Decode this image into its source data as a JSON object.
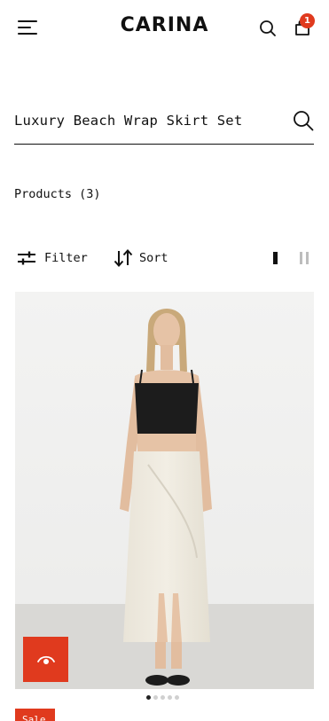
{
  "header": {
    "logo": "CARINA",
    "menu_icon": "hamburger-menu-icon",
    "search_icon": "search-icon",
    "cart_icon": "shopping-bag-icon",
    "cart_count": "1"
  },
  "search": {
    "value": "Luxury Beach Wrap Skirt Set",
    "icon": "search-icon"
  },
  "results": {
    "count_label": "Products (3)"
  },
  "toolbar": {
    "filter_label": "Filter",
    "filter_icon": "sliders-icon",
    "sort_label": "Sort",
    "sort_icon": "sort-arrows-icon",
    "view_options": [
      "single-column-view-icon",
      "two-column-view-icon"
    ],
    "active_view": "single-column-view-icon"
  },
  "product": {
    "image_alt": "Model wearing black crop top and cream beach wrap skirt",
    "quick_view_icon": "eye-icon",
    "badge": "Sale",
    "gallery_dots": 5,
    "active_dot": 0
  },
  "colors": {
    "accent": "#e03a1e",
    "text": "#111111",
    "image_background": "#efefee"
  }
}
